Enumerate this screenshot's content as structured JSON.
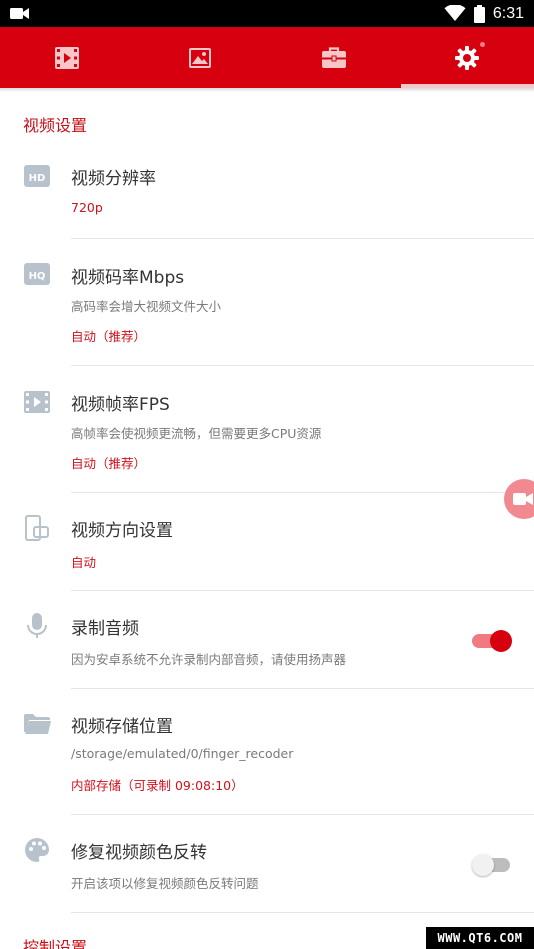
{
  "status_bar": {
    "time": "6:31"
  },
  "tabs": [
    {
      "icon": "video-film-icon",
      "active": false
    },
    {
      "icon": "image-icon",
      "active": false
    },
    {
      "icon": "toolbox-icon",
      "active": false
    },
    {
      "icon": "gear-icon",
      "active": true,
      "badge": true
    }
  ],
  "colors": {
    "accent": "#d6000f",
    "accent_text": "#c8101a",
    "switch_track_on": "#ef7b80"
  },
  "video_section": {
    "title": "视频设置",
    "items": [
      {
        "icon": "hd-icon",
        "title": "视频分辨率",
        "value": "720p"
      },
      {
        "icon": "hq-icon",
        "title": "视频码率Mbps",
        "desc": "高码率会增大视频文件大小",
        "value": "自动（推荐）"
      },
      {
        "icon": "film-icon",
        "title": "视频帧率FPS",
        "desc": "高帧率会使视频更流畅，但需要更多CPU资源",
        "value": "自动（推荐）"
      },
      {
        "icon": "screen-rotation-icon",
        "title": "视频方向设置",
        "value": "自动"
      },
      {
        "icon": "microphone-icon",
        "title": "录制音频",
        "desc": "因为安卓系统不允许录制内部音频，请使用扬声器",
        "switch_on": true
      },
      {
        "icon": "folder-icon",
        "title": "视频存储位置",
        "desc": "/storage/emulated/0/finger_recoder",
        "value": "内部存储（可录制 09:08:10）"
      },
      {
        "icon": "palette-icon",
        "title": "修复视频颜色反转",
        "desc": "开启该项以修复视频颜色反转问题",
        "switch_on": false
      }
    ]
  },
  "control_section": {
    "title": "控制设置"
  },
  "watermark": "WWW.QT6.COM"
}
